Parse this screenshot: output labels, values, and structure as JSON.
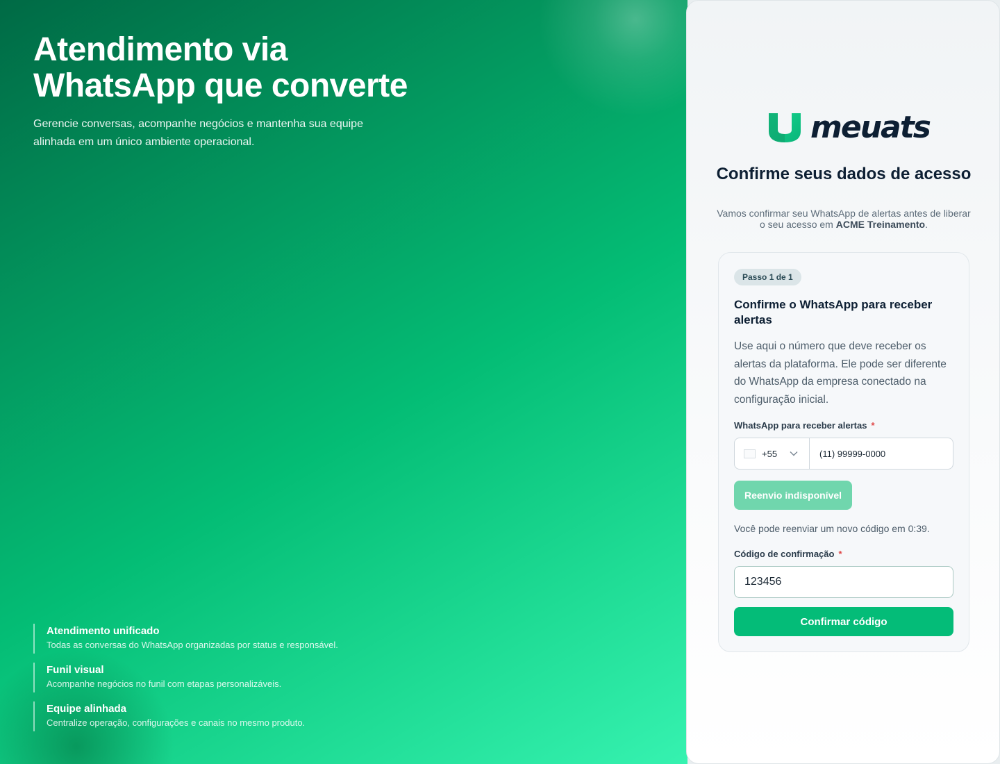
{
  "colors": {
    "brand_green": "#04bc78",
    "brand_dark": "#0d1f33",
    "disabled_button": "#70d6ad",
    "required_mark": "#e04848"
  },
  "hero": {
    "title": "Atendimento via\nWhatsApp que converte",
    "subtitle": "Gerencie conversas, acompanhe negócios e mantenha sua equipe alinhada em um único ambiente operacional.",
    "features": [
      {
        "title": "Atendimento unificado",
        "description": "Todas as conversas do WhatsApp organizadas por status e responsável."
      },
      {
        "title": "Funil visual",
        "description": "Acompanhe negócios no funil com etapas personalizáveis."
      },
      {
        "title": "Equipe alinhada",
        "description": "Centralize operação, configurações e canais no mesmo produto."
      }
    ]
  },
  "panel": {
    "logo_text": "meuats",
    "title": "Confirme seus dados de acesso",
    "subtitle_prefix": "Vamos confirmar seu WhatsApp de alertas antes de liberar o seu acesso em ",
    "company": "ACME Treinamento",
    "subtitle_suffix": ".",
    "card": {
      "step_badge": "Passo 1 de 1",
      "title": "Confirme o WhatsApp para receber alertas",
      "description": "Use aqui o número que deve receber os alertas da plataforma. Ele pode ser diferente do WhatsApp da empresa conectado na configuração inicial.",
      "phone_label": "WhatsApp para receber alertas",
      "required_mark": "*",
      "country_code": "+55",
      "phone_value": "(11) 99999-0000",
      "resend_label": "Reenvio indisponível",
      "countdown_text": "Você pode reenviar um novo código em 0:39.",
      "code_label": "Código de confirmação",
      "code_value": "123456",
      "confirm_label": "Confirmar código"
    }
  }
}
